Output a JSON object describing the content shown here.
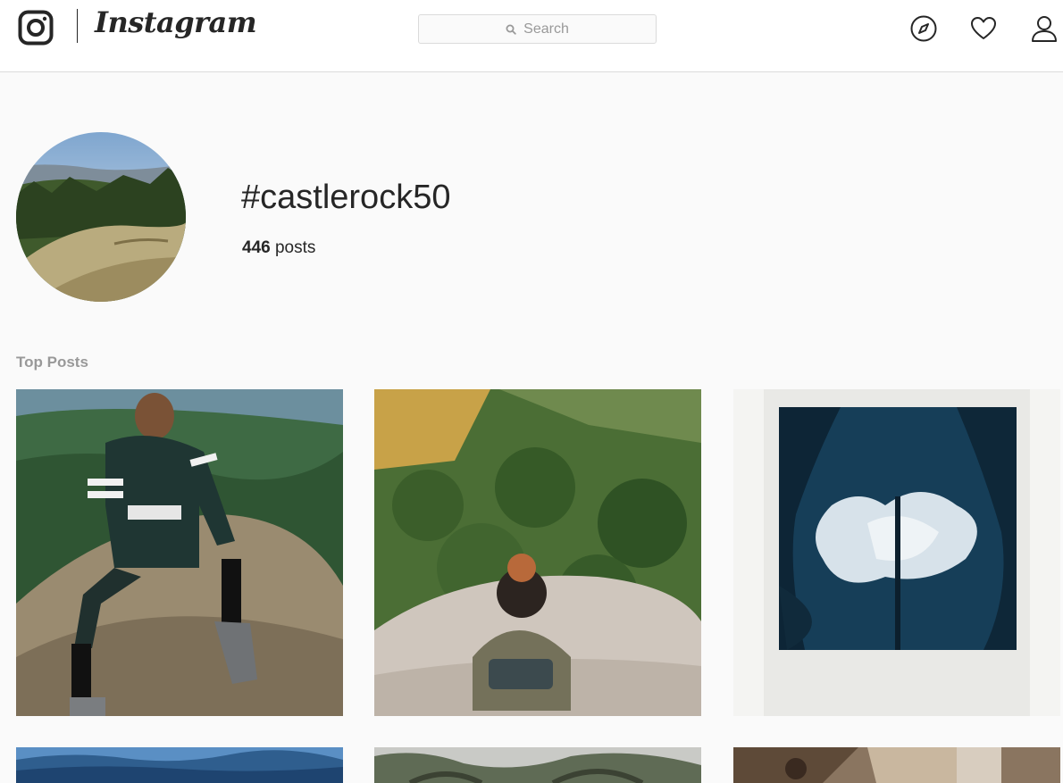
{
  "header": {
    "brand": "Instagram",
    "search": {
      "placeholder": "Search"
    },
    "icons": [
      "instagram-camera-icon",
      "compass-icon",
      "heart-icon",
      "user-icon"
    ]
  },
  "hashtag": {
    "title": "#castlerock50",
    "posts_count": "446",
    "posts_label": "posts"
  },
  "sections": {
    "top_posts": "Top Posts"
  },
  "posts": [
    {
      "id": "post-1",
      "depicts": "man sitting on boulder"
    },
    {
      "id": "post-2",
      "depicts": "woman sitting on rock overlooking forest"
    },
    {
      "id": "post-3",
      "depicts": "polaroid of sky and trees"
    },
    {
      "id": "post-4",
      "depicts": "blue mountain ridges"
    },
    {
      "id": "post-5",
      "depicts": "oak tree canopy"
    },
    {
      "id": "post-6",
      "depicts": "person near rock cave"
    }
  ],
  "colors": {
    "header_bg": "#ffffff",
    "page_bg": "#fafafa",
    "text": "#262626",
    "muted": "#999999",
    "border": "#dbdbdb"
  }
}
